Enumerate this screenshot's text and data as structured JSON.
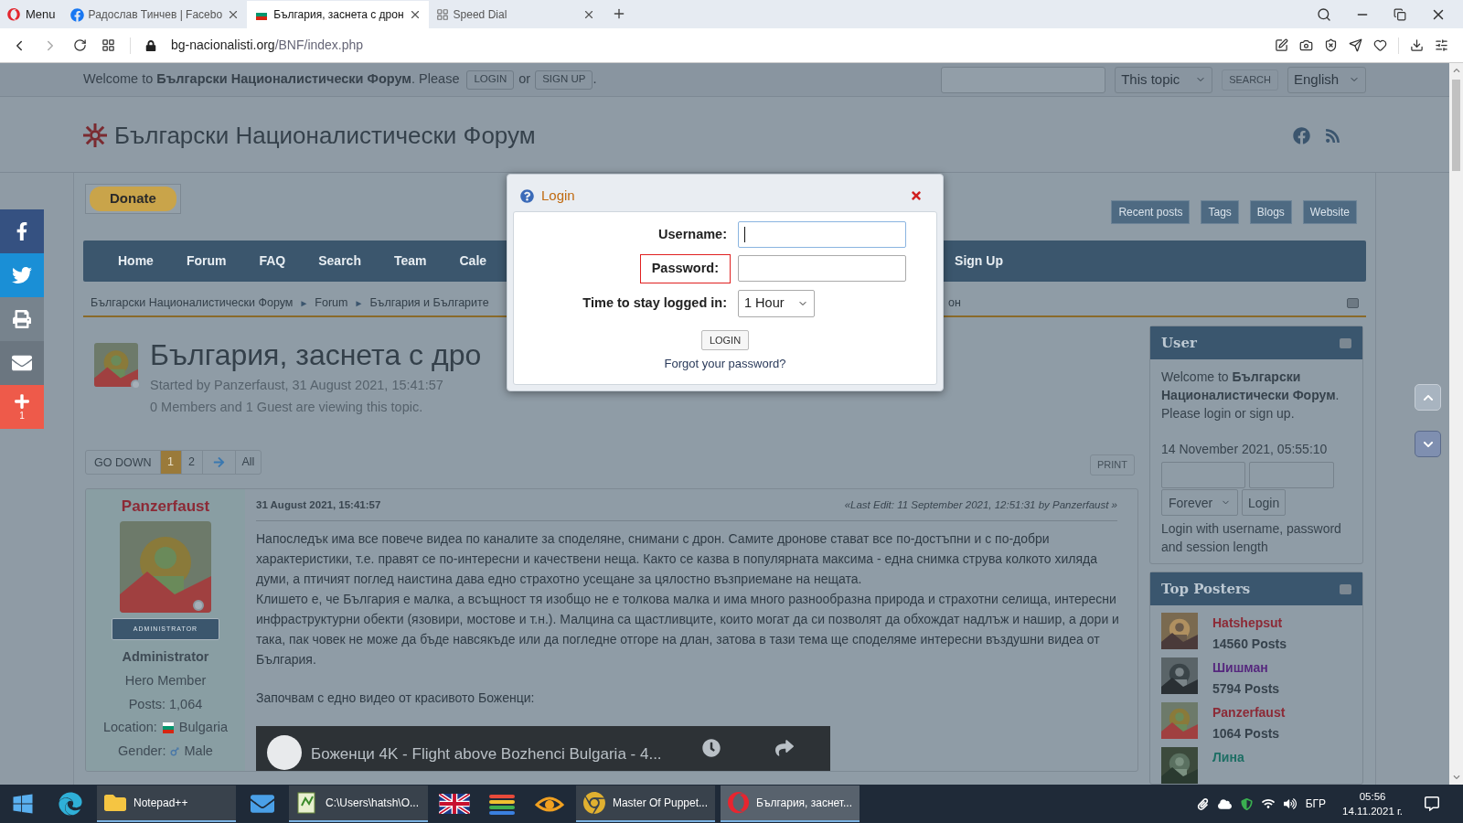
{
  "browser": {
    "menu": "Menu",
    "tabs": [
      {
        "label": "Радослав Тинчев | Facebo",
        "selected": false,
        "kind": "facebook"
      },
      {
        "label": "България, заснета с дрон",
        "selected": true,
        "kind": "flag"
      },
      {
        "label": "Speed Dial",
        "selected": false,
        "kind": "grid"
      }
    ],
    "url_domain": "bg-nacionalisti.org",
    "url_path": "/BNF/index.php"
  },
  "top_bar": {
    "welcome": "Welcome to **Български Националистически Форум**. Please",
    "login": "LOGIN",
    "or": "or",
    "signup": "SIGN UP",
    "end": ".",
    "scope": "This topic",
    "search": "SEARCH",
    "language": "English"
  },
  "header": {
    "title": "Български Националистически Форум"
  },
  "donate": "Donate",
  "quick_links": [
    "Recent posts",
    "Tags",
    "Blogs",
    "Website"
  ],
  "nav": [
    "Home",
    "Forum",
    "FAQ",
    "Search",
    "Team",
    "Cale"
  ],
  "nav_right": "Sign Up",
  "breadcrumb": [
    "Български Националистически Форум",
    "Forum",
    "България и Българите"
  ],
  "breadcrumb_separator": "►",
  "breadcrumb_tail": "он",
  "topic": {
    "title": "България, заснета с дро",
    "started_by": "Started by Panzerfaust, 31 August 2021, 15:41:57",
    "viewing": "0 Members and 1 Guest are viewing this topic."
  },
  "pagination": {
    "go_down": "GO DOWN",
    "pages": [
      {
        "label": "1",
        "selected": true
      },
      {
        "label": "2",
        "selected": false
      }
    ],
    "all": "All"
  },
  "print": "PRINT",
  "post": {
    "author": "Panzerfaust",
    "badge": "ADMINISTRATOR",
    "group": "Administrator",
    "rank": "Hero Member",
    "posts": "Posts: 1,064",
    "location_label": "Location:",
    "location": "Bulgaria",
    "gender_label": "Gender:",
    "gender": "Male",
    "date": "31 August 2021, 15:41:57",
    "last_edit": "«Last Edit: 11 September 2021, 12:51:31 by Panzerfaust »",
    "paragraphs": [
      "Напоследък има все повече видеа по каналите за споделяне, снимани с дрон. Самите дронове стават все по-достъпни и с по-добри характеристики, т.е. правят се по-интересни и качествени неща. Както се казва в популярната максима - една снимка струва колкото хиляда думи, а птичият поглед наистина дава едно страхотно усещане за цялостно възприемане на нещата.",
      "Клишето е, че България е малка, а всъщност тя изобщо не е толкова малка и има много разнообразна природа и страхотни селища, интересни инфраструктурни обекти (язовири, мостове и т.н.). Малцина са щастливците, които могат да си позволят да обхождат надлъж и нашир, а дори и така, пак човек не може да бъде навсякъде или да погледне отгоре на длан, затова в тази тема ще споделяме интересни въздушни видеа от България.",
      "Започвам с едно видео от красивото Боженци:"
    ],
    "video_title": "Боженци 4K - Flight above Bozhenci Bulgaria - 4..."
  },
  "sidebar": {
    "user": {
      "title": "User",
      "welcome": "Welcome to **Български Националистически Форум**. Please login or sign up.",
      "date": "14 November 2021, 05:55:10",
      "session": "Forever",
      "login": "Login",
      "hint": "Login with username, password and session length"
    },
    "top_posters": {
      "title": "Top Posters",
      "posters": [
        {
          "name": "Hatshepsut",
          "posts": "14560 Posts",
          "color": "#8c2a36"
        },
        {
          "name": "Шишман",
          "posts": "5794 Posts",
          "color": "#56287e"
        },
        {
          "name": "Panzerfaust",
          "posts": "1064 Posts",
          "color": "#8c2a36"
        },
        {
          "name": "Лина",
          "color": "#1d6e64"
        }
      ]
    }
  },
  "share_bar": [
    {
      "kind": "facebook"
    },
    {
      "kind": "twitter"
    },
    {
      "kind": "print"
    },
    {
      "kind": "email"
    },
    {
      "kind": "plus",
      "count": "1"
    }
  ],
  "modal": {
    "title": "Login",
    "username_label": "Username:",
    "password_label": "Password:",
    "password_highlighted": true,
    "stay_label": "Time to stay logged in:",
    "stay_value": "1 Hour",
    "login": "LOGIN",
    "forgot": "Forgot your password?"
  },
  "taskbar": {
    "items": [
      {
        "kind": "start"
      },
      {
        "kind": "edge"
      },
      {
        "kind": "folder",
        "label": "Notepad++",
        "active": false
      },
      {
        "kind": "mail"
      },
      {
        "kind": "notepad",
        "label": "C:\\Users\\hatsh\\O...",
        "active": false
      },
      {
        "kind": "ukflag"
      },
      {
        "kind": "stack"
      },
      {
        "kind": "eye"
      },
      {
        "kind": "chrome",
        "label": "Master Of Puppet...",
        "active": false
      },
      {
        "kind": "opera",
        "label": "България, заснет...",
        "active": true
      }
    ],
    "language": "БГР",
    "time": "05:56",
    "date": "14.11.2021 г."
  }
}
